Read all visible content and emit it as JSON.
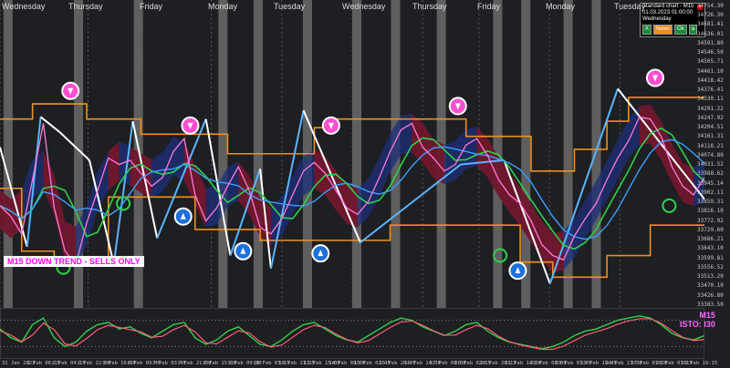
{
  "chart_data": {
    "type": "line",
    "title": "",
    "symbol_timeframe": "M15",
    "trend_banner": "M15  DOWN TREND - SELLS ONLY",
    "oscillator_labels": [
      "M15",
      "ISTO: I30"
    ],
    "info_panel": {
      "title": "Standard chart - M15",
      "date": "01.03.2023",
      "time": "01:00:00",
      "day": "Wednesday",
      "buttons": [
        "X",
        "News",
        "Ok",
        "a"
      ]
    },
    "day_labels": [
      "Wednesday",
      "Thursday",
      "Friday",
      "Monday",
      "Tuesday",
      "Wednesday",
      "Thursday",
      "Friday",
      "Monday",
      "Tuesday"
    ],
    "price_axis": [
      "34754.30",
      "34726.30",
      "34681.41",
      "34636.01",
      "34591.80",
      "34546.50",
      "34505.71",
      "34461.10",
      "34418.42",
      "34376.41",
      "34330.11",
      "34291.22",
      "34247.92",
      "34204.51",
      "34161.31",
      "34118.21",
      "34074.80",
      "34031.52",
      "33988.62",
      "33945.14",
      "33902.11",
      "33859.31",
      "33816.10",
      "33772.92",
      "33729.60",
      "33686.21",
      "33643.10",
      "33599.81",
      "33556.52",
      "33513.20",
      "33470.10",
      "33426.80",
      "33383.50"
    ],
    "date_axis": [
      "31 Jan 2023",
      "1 Feb 06:15",
      "2 Feb 04:15",
      "2 Feb 22:00",
      "3 Feb 16:00",
      "6 Feb 09:45",
      "7 Feb 03:45",
      "7 Feb 21:30",
      "8 Feb 15:30",
      "9 Feb 09:30",
      "10 Feb 03:15",
      "10 Feb 21:15",
      "13 Feb 15:00",
      "14 Feb 09:00",
      "15 Feb 02:45",
      "15 Feb 20:45",
      "16 Feb 14:30",
      "17 Feb 08:30",
      "20 Feb 02:15",
      "20 Feb 20:15",
      "21 Feb 14:00",
      "22 Feb 08:00",
      "23 Feb 01:45",
      "23 Feb 19:45",
      "24 Feb 13:30",
      "27 Feb 07:30",
      "28 Feb 01:15",
      "28 Feb 19:15"
    ],
    "price": [
      33830,
      33780,
      33700,
      33950,
      34210,
      33820,
      33620,
      33560,
      33750,
      33900,
      34050,
      34020,
      34040,
      33980,
      33920,
      33960,
      34080,
      34140,
      33880,
      33760,
      33820,
      33920,
      34010,
      33900,
      33730,
      33700,
      33770,
      33880,
      33990,
      34030,
      33980,
      33900,
      33820,
      33790,
      33850,
      33960,
      34080,
      34180,
      34210,
      34100,
      34050,
      33990,
      34020,
      34110,
      34140,
      34060,
      33950,
      33880,
      33840,
      33760,
      33650,
      33600,
      33580,
      33690,
      33770,
      33840,
      33950,
      34050,
      34130,
      34240,
      34230,
      34150,
      34010,
      33920,
      33880,
      33960
    ],
    "channel_upper": [
      34230,
      34230,
      34230,
      34300,
      34300,
      34300,
      34300,
      34300,
      34230,
      34230,
      34230,
      34230,
      34230,
      34160,
      34160,
      34160,
      34160,
      34160,
      34160,
      34160,
      34160,
      34070,
      34070,
      34070,
      34070,
      34070,
      34070,
      34070,
      34070,
      34190,
      34190,
      34230,
      34230,
      34230,
      34230,
      34230,
      34230,
      34230,
      34230,
      34230,
      34230,
      34230,
      34230,
      34150,
      34150,
      34150,
      34150,
      34150,
      34150,
      33990,
      33990,
      33990,
      33990,
      34090,
      34090,
      34090,
      34220,
      34220,
      34330,
      34330,
      34330,
      34330,
      34330,
      34330,
      34330,
      34330
    ],
    "channel_lower": [
      33910,
      33910,
      33620,
      33620,
      33620,
      33580,
      33580,
      33580,
      33580,
      33580,
      33870,
      33870,
      33870,
      33870,
      33870,
      33870,
      33870,
      33870,
      33720,
      33720,
      33720,
      33720,
      33720,
      33720,
      33670,
      33670,
      33670,
      33670,
      33670,
      33670,
      33670,
      33670,
      33670,
      33670,
      33670,
      33670,
      33740,
      33740,
      33740,
      33740,
      33740,
      33740,
      33740,
      33740,
      33740,
      33740,
      33740,
      33740,
      33570,
      33570,
      33570,
      33500,
      33500,
      33500,
      33500,
      33500,
      33600,
      33600,
      33600,
      33600,
      33740,
      33740,
      33740,
      33740,
      33740,
      33740
    ],
    "oscillator": [
      60,
      40,
      30,
      70,
      85,
      40,
      20,
      30,
      55,
      70,
      75,
      60,
      65,
      50,
      40,
      55,
      70,
      75,
      40,
      25,
      35,
      55,
      65,
      45,
      25,
      20,
      35,
      55,
      70,
      75,
      60,
      45,
      35,
      30,
      45,
      60,
      75,
      85,
      80,
      65,
      55,
      45,
      55,
      70,
      75,
      55,
      40,
      30,
      25,
      20,
      15,
      20,
      30,
      45,
      55,
      60,
      70,
      80,
      85,
      90,
      85,
      70,
      50,
      40,
      35,
      45
    ],
    "zigzag_points": [
      [
        0,
        34100
      ],
      [
        10,
        33640
      ],
      [
        15,
        34240
      ],
      [
        22,
        34170
      ],
      [
        33,
        34040
      ],
      [
        42,
        33560
      ],
      [
        49,
        34220
      ],
      [
        58,
        33680
      ],
      [
        76,
        34230
      ],
      [
        85,
        33600
      ],
      [
        96,
        34000
      ],
      [
        100,
        33540
      ],
      [
        112,
        34270
      ],
      [
        133,
        33660
      ],
      [
        170,
        34020
      ],
      [
        186,
        34040
      ],
      [
        203,
        33470
      ],
      [
        228,
        34370
      ],
      [
        260,
        33860
      ]
    ],
    "ylim": [
      33383.5,
      34754.3
    ],
    "grid": false
  }
}
